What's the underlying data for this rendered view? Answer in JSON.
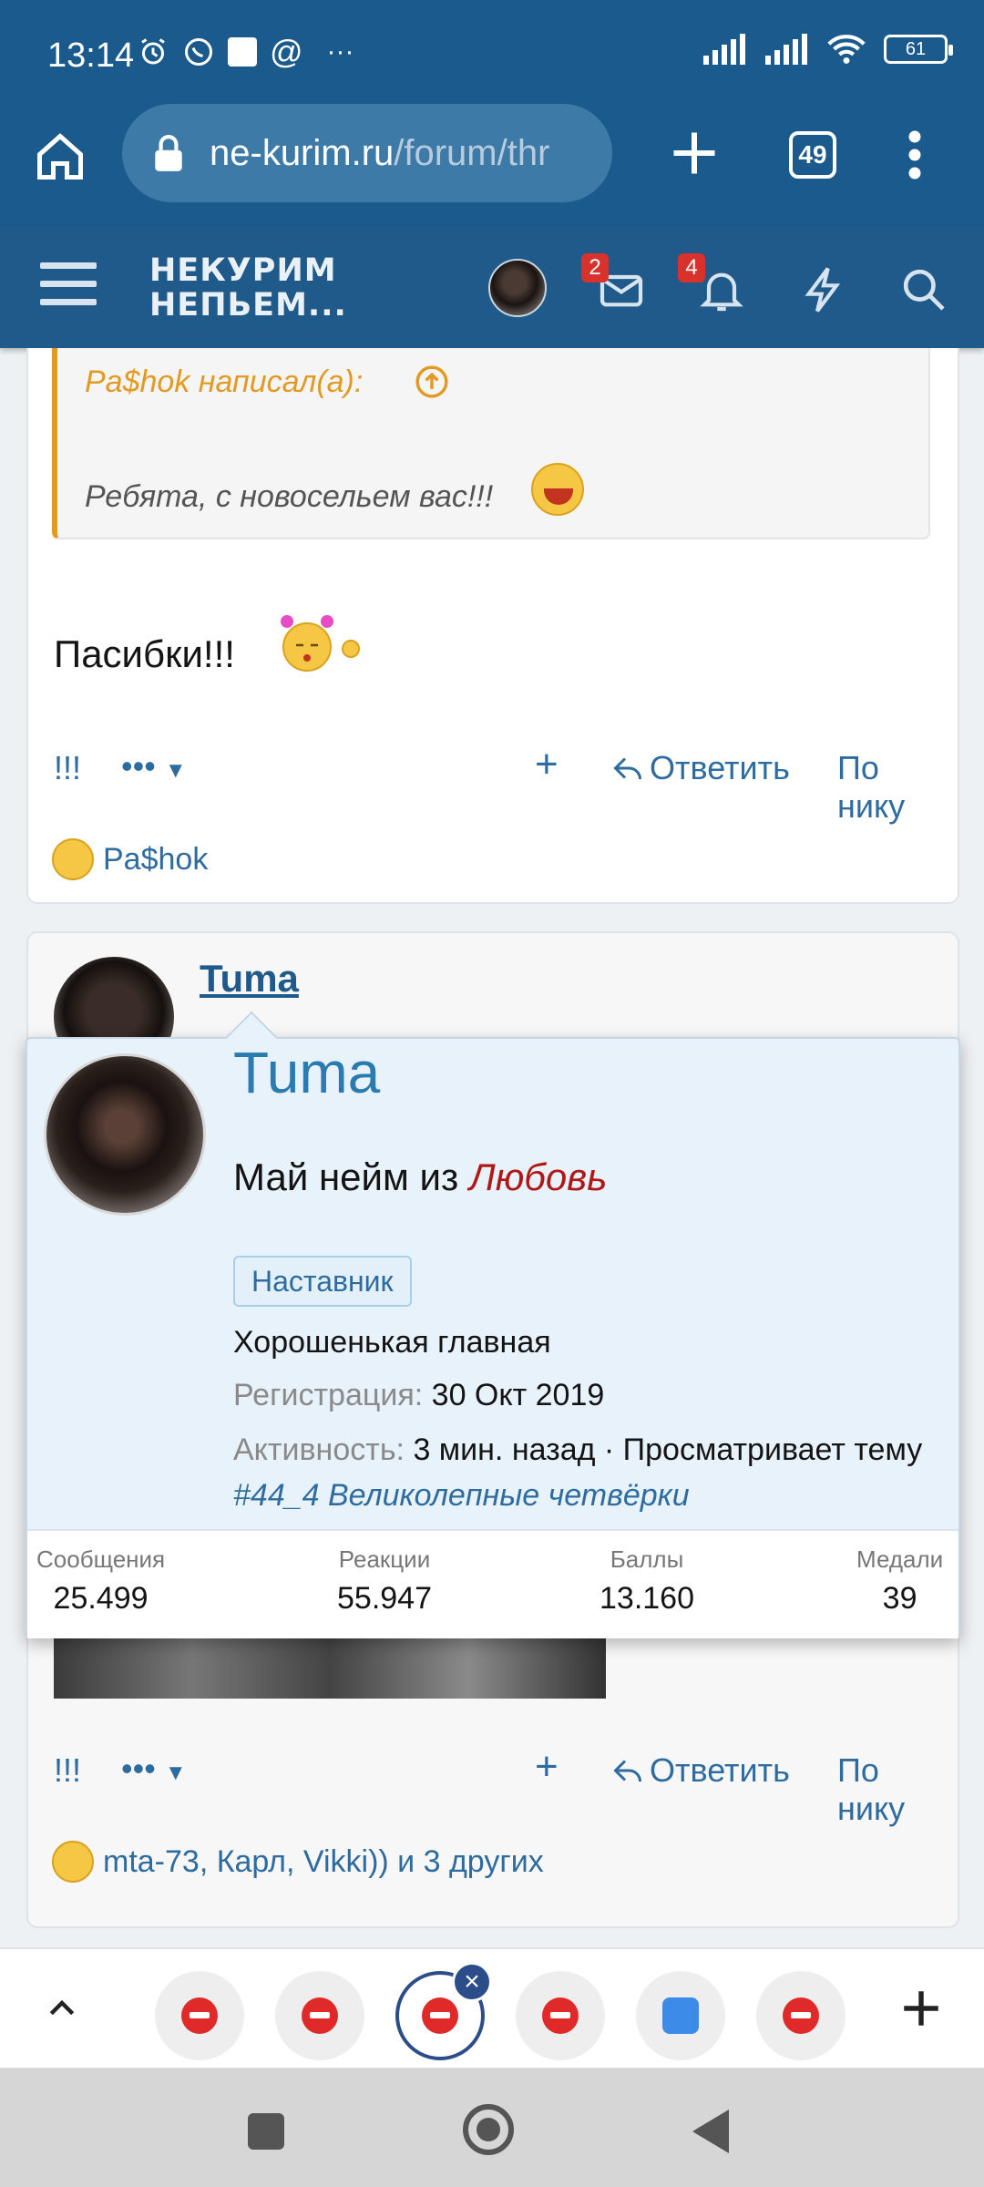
{
  "status_bar": {
    "time": "13:14",
    "battery": "61",
    "more_dots": "···"
  },
  "browser": {
    "url_host": "ne-kurim.ru",
    "url_path": "/forum/thr",
    "tab_count": "49"
  },
  "forum_header": {
    "logo_line1": "НЕКУРИМ",
    "logo_line2": "НЕПЬЕМ...",
    "messages_badge": "2",
    "alerts_badge": "4"
  },
  "post1": {
    "quote_author": "Pa$hok написал(а):",
    "quote_text": "Ребята, с новосельем вас!!!",
    "text": "Пасибки!!!",
    "actions": {
      "bang": "!!!",
      "more": "•••",
      "plus": "+",
      "reply": "Ответить",
      "by_nick": "По нику"
    },
    "reactions": "Pa$hok"
  },
  "post2": {
    "author": "Tuma",
    "actions": {
      "bang": "!!!",
      "more": "•••",
      "plus": "+",
      "reply": "Ответить",
      "by_nick": "По нику"
    },
    "reactions": "mta-73, Карл, Vikki)) и 3 других"
  },
  "tooltip": {
    "name": "Tuma",
    "title_prefix": "Май нейм из",
    "title_love": "Любовь",
    "badge": "Наставник",
    "subtitle": "Хорошенькая главная",
    "reg_label": "Регистрация:",
    "reg_value": "30 Окт 2019",
    "act_label": "Активность:",
    "act_value": "3 мин. назад · Просматривает тему",
    "act_link": "#44_4 Великолепные четвёрки",
    "stats": [
      {
        "label": "Сообщения",
        "value": "25.499"
      },
      {
        "label": "Реакции",
        "value": "55.947"
      },
      {
        "label": "Баллы",
        "value": "13.160"
      },
      {
        "label": "Медали",
        "value": "39"
      }
    ]
  },
  "colors": {
    "toolbar": "#1a5a8c",
    "accent": "#2e6ca0",
    "quote_border": "#e39a23",
    "badge_red": "#d9312c"
  }
}
